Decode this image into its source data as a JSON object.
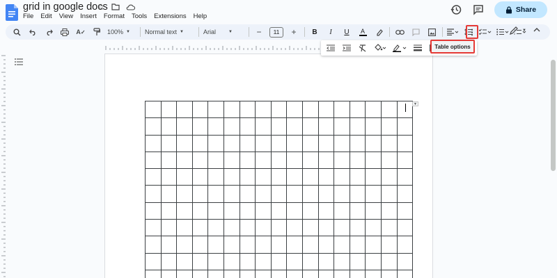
{
  "doc": {
    "title": "grid in google docs"
  },
  "menu": [
    "File",
    "Edit",
    "View",
    "Insert",
    "Format",
    "Tools",
    "Extensions",
    "Help"
  ],
  "header_actions": {
    "share_label": "Share",
    "icons": [
      "history-icon",
      "comment-icon",
      "lock-icon"
    ]
  },
  "toolbar": {
    "zoom": "100%",
    "paragraph_style": "Normal text",
    "font": "Arial",
    "font_size": "11",
    "icons": [
      "search-icon",
      "undo-icon",
      "redo-icon",
      "print-icon",
      "spellcheck-icon",
      "paint-format-icon",
      "bold-icon",
      "italic-icon",
      "underline-icon",
      "text-color-icon",
      "highlight-icon",
      "link-icon",
      "comment-add-icon",
      "image-icon",
      "align-icon",
      "line-spacing-icon",
      "checklist-icon",
      "bulleted-list-icon",
      "numbered-list-icon",
      "more-icon",
      "editing-mode-icon",
      "collapse-icon"
    ]
  },
  "overflow_menu": {
    "icons": [
      "indent-decrease-icon",
      "indent-increase-icon",
      "clear-format-icon",
      "cell-fill-icon",
      "border-color-icon",
      "border-width-icon",
      "border-dash-icon"
    ],
    "table_options_label": "Table options"
  },
  "table": {
    "columns": 17,
    "visible_rows": 11
  },
  "colors": {
    "accent": "#1a73e8",
    "share_bg": "#c2e7ff",
    "toolbar_bg": "#edf2fa",
    "highlight_border": "#e53935"
  }
}
